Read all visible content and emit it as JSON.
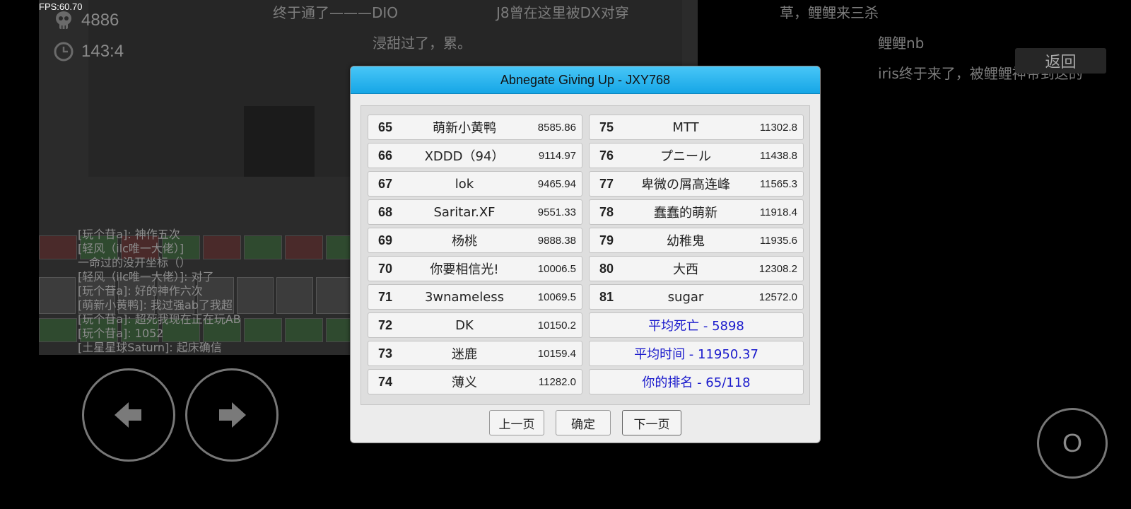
{
  "hud": {
    "fps": "FPS:60.70",
    "deaths": "4886",
    "time": "143:4"
  },
  "danmaku": [
    "终于通了———DIO",
    "J8曾在这里被DX对穿",
    "草，鲤鲤来三杀",
    "浸甜过了，累。",
    "鲤鲤nb",
    "iris终于来了，被鲤鲤神带到这的"
  ],
  "chat_log": [
    "[玩个苷a]: 神作五次",
    "[轻风（ilc唯一大佬）]",
    "一命过的没开坐标（）",
    "[轻风（ilc唯一大佬）]: 对了",
    "[玩个苷a]: 好的神作六次",
    "[萌新小黄鸭]: 我过强ab了我超",
    "[玩个苷a]: 超死我现在正在玩AB",
    "[玩个苷a]: 1052",
    "[土星星球Saturn]: 起床确信"
  ],
  "back_button": "返回",
  "jump_button": "O",
  "dialog": {
    "title": "Abnegate Giving Up - JXY768",
    "left_ranks": [
      {
        "rank": "65",
        "name": "萌新小黄鸭",
        "score": "8585.86"
      },
      {
        "rank": "66",
        "name": "XDDD（94）",
        "score": "9114.97"
      },
      {
        "rank": "67",
        "name": "lok",
        "score": "9465.94"
      },
      {
        "rank": "68",
        "name": "Saritar.XF",
        "score": "9551.33"
      },
      {
        "rank": "69",
        "name": "杨桃",
        "score": "9888.38"
      },
      {
        "rank": "70",
        "name": "你要相信光!",
        "score": "10006.5"
      },
      {
        "rank": "71",
        "name": "3wnameless",
        "score": "10069.5"
      },
      {
        "rank": "72",
        "name": "DK",
        "score": "10150.2"
      },
      {
        "rank": "73",
        "name": "迷鹿",
        "score": "10159.4"
      },
      {
        "rank": "74",
        "name": "薄义",
        "score": "11282.0"
      }
    ],
    "right_ranks": [
      {
        "rank": "75",
        "name": "MTT",
        "score": "11302.8"
      },
      {
        "rank": "76",
        "name": "プニール",
        "score": "11438.8"
      },
      {
        "rank": "77",
        "name": "卑微の屑高连峰",
        "score": "11565.3"
      },
      {
        "rank": "78",
        "name": "蠢蠢的萌新",
        "score": "11918.4"
      },
      {
        "rank": "79",
        "name": "幼稚鬼",
        "score": "11935.6"
      },
      {
        "rank": "80",
        "name": "大西",
        "score": "12308.2"
      },
      {
        "rank": "81",
        "name": "sugar",
        "score": "12572.0"
      }
    ],
    "stats": {
      "avg_deaths": "平均死亡 - 5898",
      "avg_time": "平均时间 - 11950.37",
      "your_rank": "你的排名 - 65/118"
    },
    "buttons": {
      "prev": "上一页",
      "confirm": "确定",
      "next": "下一页"
    }
  }
}
